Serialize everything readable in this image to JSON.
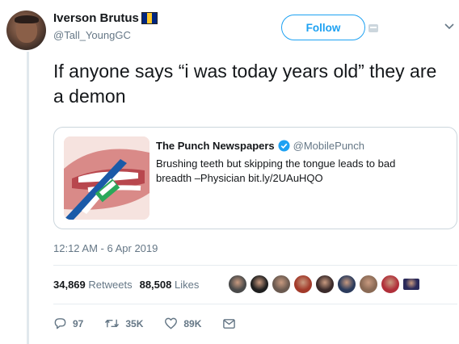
{
  "user": {
    "display_name": "Iverson Brutus",
    "handle": "@Tall_YoungGC",
    "flag_colors": [
      "#00267f",
      "#ffc726",
      "#00267f"
    ]
  },
  "follow_label": "Follow",
  "tweet": {
    "text": "If anyone says “i was today years old” they are a demon"
  },
  "quoted": {
    "name": "The Punch Newspapers",
    "handle": "@MobilePunch",
    "text": "Brushing teeth but skipping the tongue leads to bad breadth –Physician bit.ly/2UAuHQO"
  },
  "timestamp": "12:12 AM - 6 Apr 2019",
  "stats": {
    "retweets_count": "34,869",
    "retweets_label": "Retweets",
    "likes_count": "88,508",
    "likes_label": "Likes"
  },
  "likers": [
    "#4a4a4a",
    "#1f1f1f",
    "#6b5a50",
    "#a23a2a",
    "#3a2a2a",
    "#2b3b5c",
    "#8a6a55",
    "#b0303a",
    "#2a2a5a"
  ],
  "actions": {
    "replies": "97",
    "retweets": "35K",
    "likes": "89K"
  },
  "colors": {
    "accent": "#1da1f2",
    "secondary_text": "#657786",
    "verified": "#1da1f2"
  }
}
